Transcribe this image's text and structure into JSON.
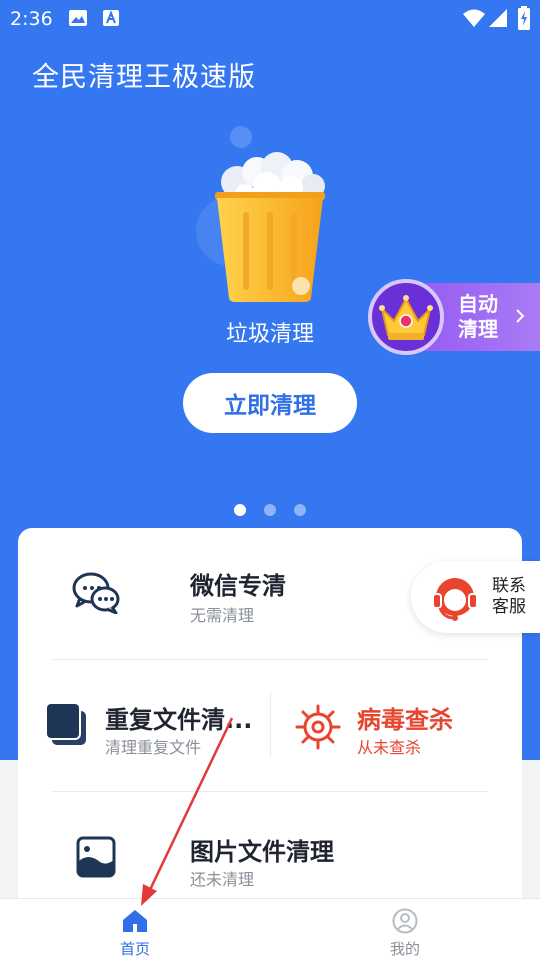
{
  "status_bar": {
    "time": "2:36",
    "icons": [
      "image-icon",
      "a-app-icon",
      "wifi-icon",
      "signal-icon",
      "battery-charging-icon"
    ]
  },
  "app": {
    "title": "全民清理王极速版"
  },
  "banner": {
    "trash_label": "垃圾清理",
    "clean_button": "立即清理",
    "auto_clean_line1": "自动",
    "auto_clean_line2": "清理",
    "page_count": 3,
    "active_page": 1
  },
  "features": {
    "wechat": {
      "title": "微信专清",
      "subtitle": "无需清理",
      "icon": "wechat-icon"
    },
    "duplicate": {
      "title": "重复文件清...",
      "subtitle": "清理重复文件",
      "icon": "duplicate-files-icon"
    },
    "virus": {
      "title": "病毒查杀",
      "subtitle": "从未查杀",
      "icon": "virus-icon"
    },
    "photo": {
      "title": "图片文件清理",
      "subtitle": "还未清理",
      "icon": "image-file-icon"
    }
  },
  "customer_service": {
    "line1": "联系",
    "line2": "客服"
  },
  "bottom_nav": {
    "home": "首页",
    "mine": "我的"
  },
  "colors": {
    "primary_blue": "#3477f0",
    "virus_red": "#e8452f",
    "dark_text": "#1f2430",
    "purple": "#8e4ef0"
  }
}
